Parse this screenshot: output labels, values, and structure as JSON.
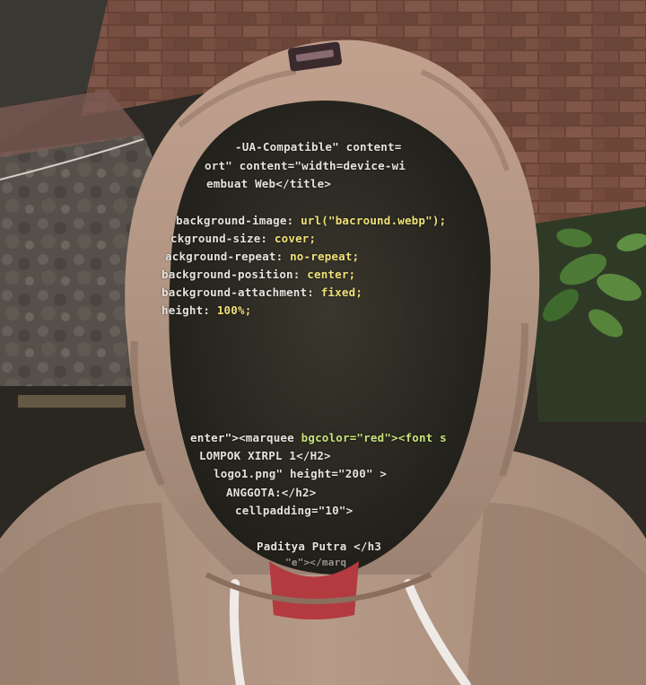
{
  "colors": {
    "hoodie": "#b89a86",
    "hoodie_shadow": "#7e6254",
    "face_dark": "#2b2a22",
    "brick": "#6e4a3c",
    "wall_stone": "#5a5248",
    "shirt": "#b33a3f",
    "drawstring": "#efeae6",
    "leaves": "#3f6a2e"
  },
  "code_lines": [
    {
      "a": "-UA-Compatible\" content=",
      "b": ""
    },
    {
      "a": "ort\" content=\"width=device-wi",
      "b": ""
    },
    {
      "a": "embuat Web</title>",
      "b": ""
    },
    {
      "a": "background-image: ",
      "b": "url(\"bacround.webp\");"
    },
    {
      "a": "ckground-size: ",
      "b": "cover;"
    },
    {
      "a": "ackground-repeat: ",
      "b": "no-repeat;"
    },
    {
      "a": "background-position: ",
      "b": "center;"
    },
    {
      "a": "background-attachment: ",
      "b": "fixed;"
    },
    {
      "a": "height: ",
      "b": "100%;"
    },
    {
      "a": "enter\"><marquee ",
      "b": "bgcolor=\"red\"><font s"
    },
    {
      "a": "LOMPOK XIRPL 1</H2>",
      "b": ""
    },
    {
      "a": "logo1.png\" height=\"200\" >",
      "b": ""
    },
    {
      "a": "ANGGOTA:</h2>",
      "b": ""
    },
    {
      "a": "cellpadding=\"10\">",
      "b": ""
    },
    {
      "a": "Paditya Putra </h3",
      "b": ""
    },
    {
      "a": "\"e\"></marq",
      "b": ""
    }
  ]
}
